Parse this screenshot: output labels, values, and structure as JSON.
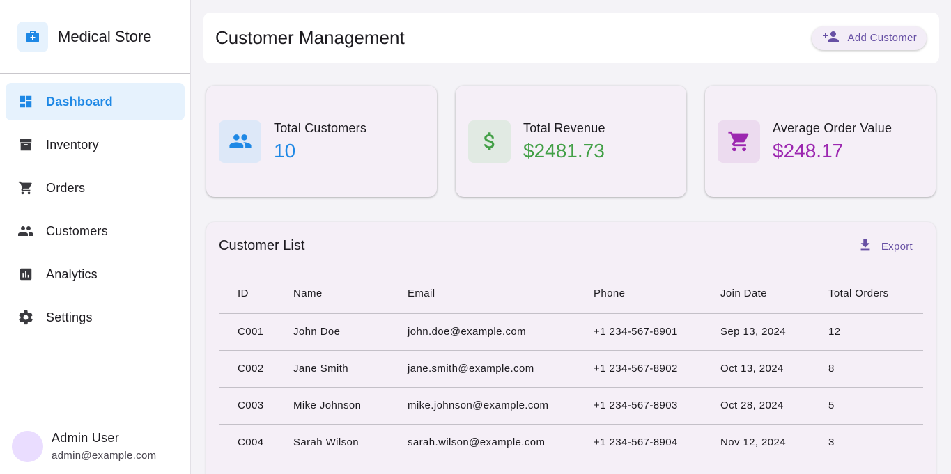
{
  "brand": {
    "name": "Medical Store",
    "icon": "medical-bag-icon"
  },
  "sidebar": {
    "items": [
      {
        "label": "Dashboard",
        "icon": "dashboard-icon",
        "active": true
      },
      {
        "label": "Inventory",
        "icon": "archive-icon"
      },
      {
        "label": "Orders",
        "icon": "cart-icon"
      },
      {
        "label": "Customers",
        "icon": "people-icon"
      },
      {
        "label": "Analytics",
        "icon": "analytics-icon"
      },
      {
        "label": "Settings",
        "icon": "gear-icon"
      }
    ]
  },
  "user": {
    "name": "Admin User",
    "email": "admin@example.com"
  },
  "header": {
    "title": "Customer Management",
    "add_button": "Add Customer"
  },
  "stats": [
    {
      "label": "Total Customers",
      "value": "10",
      "color": "#1e88e5",
      "bg": "#dde8f8",
      "icon": "people-icon"
    },
    {
      "label": "Total Revenue",
      "value": "$2481.73",
      "color": "#43a047",
      "bg": "#e1eae3",
      "icon": "dollar-icon"
    },
    {
      "label": "Average Order Value",
      "value": "$248.17",
      "color": "#9c27b0",
      "bg": "#ecdbef",
      "icon": "cart-icon"
    }
  ],
  "customer_list": {
    "title": "Customer List",
    "export_label": "Export",
    "columns": [
      "ID",
      "Name",
      "Email",
      "Phone",
      "Join Date",
      "Total Orders"
    ],
    "rows": [
      [
        "C001",
        "John Doe",
        "john.doe@example.com",
        "+1 234-567-8901",
        "Sep 13, 2024",
        "12"
      ],
      [
        "C002",
        "Jane Smith",
        "jane.smith@example.com",
        "+1 234-567-8902",
        "Oct 13, 2024",
        "8"
      ],
      [
        "C003",
        "Mike Johnson",
        "mike.johnson@example.com",
        "+1 234-567-8903",
        "Oct 28, 2024",
        "5"
      ],
      [
        "C004",
        "Sarah Wilson",
        "sarah.wilson@example.com",
        "+1 234-567-8904",
        "Nov 12, 2024",
        "3"
      ]
    ]
  },
  "colors": {
    "accent": "#1e88e5",
    "primary_purple": "#6750a4"
  }
}
